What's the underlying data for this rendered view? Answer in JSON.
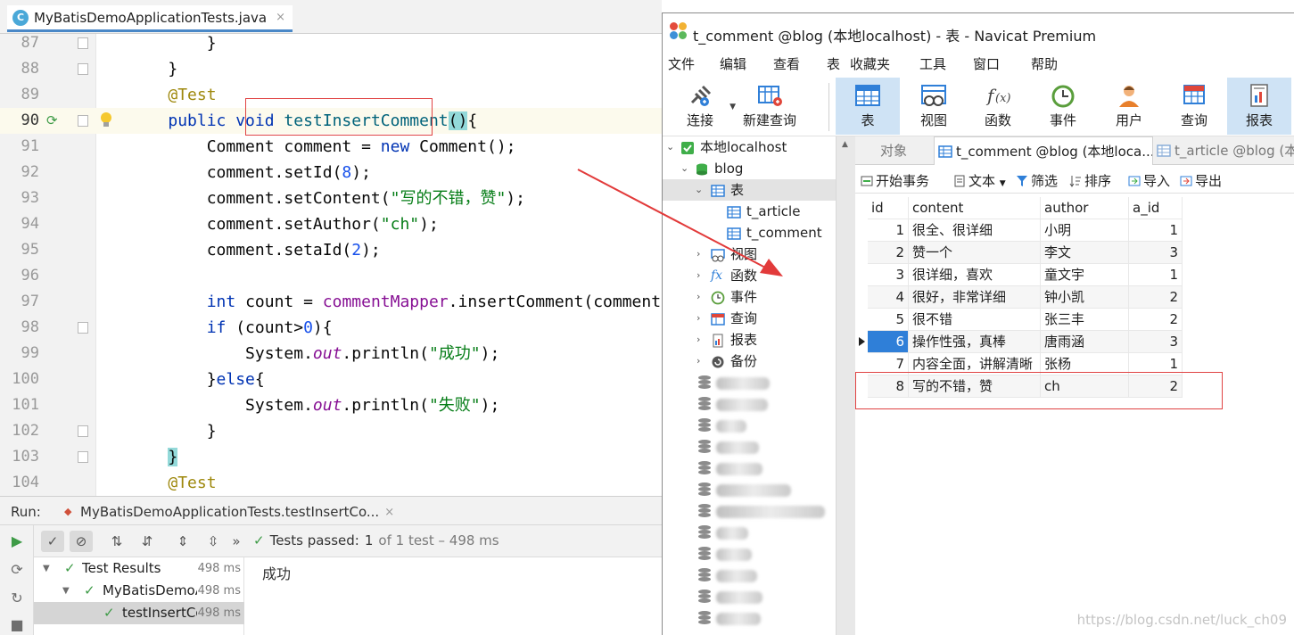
{
  "ide": {
    "tab_label": "MyBatisDemoApplicationTests.java",
    "tab_icon_letter": "C",
    "tab_close": "×",
    "lines": [
      {
        "n": "87",
        "parts": [
          {
            "t": "        }",
            "c": ""
          }
        ]
      },
      {
        "n": "88",
        "parts": [
          {
            "t": "    }",
            "c": ""
          }
        ]
      },
      {
        "n": "89",
        "parts": [
          {
            "t": "    ",
            "c": ""
          },
          {
            "t": "@Test",
            "c": "ann"
          }
        ]
      },
      {
        "n": "90",
        "parts": [
          {
            "t": "    ",
            "c": ""
          },
          {
            "t": "public void ",
            "c": "kw"
          },
          {
            "t": "testInsertComment",
            "c": "mth"
          },
          {
            "t": "()",
            "c": "brace-hl"
          },
          {
            "t": "{",
            "c": ""
          }
        ]
      },
      {
        "n": "91",
        "parts": [
          {
            "t": "        Comment comment = ",
            "c": ""
          },
          {
            "t": "new ",
            "c": "kw"
          },
          {
            "t": "Comment();",
            "c": ""
          }
        ]
      },
      {
        "n": "92",
        "parts": [
          {
            "t": "        comment.setId(",
            "c": ""
          },
          {
            "t": "8",
            "c": "num"
          },
          {
            "t": ");",
            "c": ""
          }
        ]
      },
      {
        "n": "93",
        "parts": [
          {
            "t": "        comment.setContent(",
            "c": ""
          },
          {
            "t": "\"写的不错，赞\"",
            "c": "str"
          },
          {
            "t": ");",
            "c": ""
          }
        ]
      },
      {
        "n": "94",
        "parts": [
          {
            "t": "        comment.setAuthor(",
            "c": ""
          },
          {
            "t": "\"ch\"",
            "c": "str"
          },
          {
            "t": ");",
            "c": ""
          }
        ]
      },
      {
        "n": "95",
        "parts": [
          {
            "t": "        comment.setaId(",
            "c": ""
          },
          {
            "t": "2",
            "c": "num"
          },
          {
            "t": ");",
            "c": ""
          }
        ]
      },
      {
        "n": "96",
        "parts": []
      },
      {
        "n": "97",
        "parts": [
          {
            "t": "        ",
            "c": ""
          },
          {
            "t": "int ",
            "c": "kw"
          },
          {
            "t": "count = ",
            "c": ""
          },
          {
            "t": "commentMapper",
            "c": "fld"
          },
          {
            "t": ".insertComment(comment);",
            "c": ""
          }
        ]
      },
      {
        "n": "98",
        "parts": [
          {
            "t": "        ",
            "c": ""
          },
          {
            "t": "if ",
            "c": "kw"
          },
          {
            "t": "(count>",
            "c": ""
          },
          {
            "t": "0",
            "c": "num"
          },
          {
            "t": "){",
            "c": ""
          }
        ]
      },
      {
        "n": "99",
        "parts": [
          {
            "t": "            System.",
            "c": ""
          },
          {
            "t": "out",
            "c": "stat"
          },
          {
            "t": ".println(",
            "c": ""
          },
          {
            "t": "\"成功\"",
            "c": "str"
          },
          {
            "t": ");",
            "c": ""
          }
        ]
      },
      {
        "n": "100",
        "parts": [
          {
            "t": "        }",
            "c": ""
          },
          {
            "t": "else",
            "c": "kw"
          },
          {
            "t": "{",
            "c": ""
          }
        ]
      },
      {
        "n": "101",
        "parts": [
          {
            "t": "            System.",
            "c": ""
          },
          {
            "t": "out",
            "c": "stat"
          },
          {
            "t": ".println(",
            "c": ""
          },
          {
            "t": "\"失败\"",
            "c": "str"
          },
          {
            "t": ");",
            "c": ""
          }
        ]
      },
      {
        "n": "102",
        "parts": [
          {
            "t": "        }",
            "c": ""
          }
        ]
      },
      {
        "n": "103",
        "parts": [
          {
            "t": "    ",
            "c": ""
          },
          {
            "t": "}",
            "c": "brace-hl"
          }
        ]
      },
      {
        "n": "104",
        "parts": [
          {
            "t": "    ",
            "c": ""
          },
          {
            "t": "@Test",
            "c": "ann"
          }
        ]
      }
    ]
  },
  "run": {
    "label": "Run:",
    "config_name": "MyBatisDemoApplicationTests.testInsertCo...",
    "config_close": "×",
    "more": "»",
    "status_passed": "Tests passed:",
    "status_count": "1",
    "status_rest": "of 1 test – 498 ms",
    "tree": [
      {
        "label": "Test Results",
        "time": "498 ms"
      },
      {
        "label": "MyBatisDemoA",
        "time": "498 ms"
      },
      {
        "label": "testInsertCo",
        "time": "498 ms"
      }
    ],
    "console_output": "成功"
  },
  "navicat": {
    "title": "t_comment @blog (本地localhost) - 表 - Navicat Premium",
    "menu": [
      "文件",
      "编辑",
      "查看",
      "表",
      "收藏夹",
      "工具",
      "窗口",
      "帮助"
    ],
    "toolbar": [
      {
        "label": "连接",
        "icon": "plug-icon"
      },
      {
        "label": "新建查询",
        "icon": "new-query-icon"
      },
      {
        "label": "表",
        "icon": "table-icon"
      },
      {
        "label": "视图",
        "icon": "view-icon"
      },
      {
        "label": "函数",
        "icon": "function-icon"
      },
      {
        "label": "事件",
        "icon": "clock-icon"
      },
      {
        "label": "用户",
        "icon": "user-icon"
      },
      {
        "label": "查询",
        "icon": "query-icon"
      },
      {
        "label": "报表",
        "icon": "report-icon"
      }
    ],
    "tree": {
      "connection": "本地localhost",
      "database": "blog",
      "tables_node": "表",
      "tables": [
        "t_article",
        "t_comment"
      ],
      "other_nodes": [
        "视图",
        "函数",
        "事件",
        "查询",
        "报表",
        "备份"
      ],
      "blurred_db_count": 12
    },
    "tabs": [
      "对象",
      "t_comment @blog (本地loca...",
      "t_article @blog (本"
    ],
    "subtoolbar": [
      "开始事务",
      "文本",
      "筛选",
      "排序",
      "导入",
      "导出"
    ],
    "columns": [
      "id",
      "content",
      "author",
      "a_id"
    ],
    "rows": [
      [
        "1",
        "很全、很详细",
        "小明",
        "1"
      ],
      [
        "2",
        "赞一个",
        "李文",
        "3"
      ],
      [
        "3",
        "很详细，喜欢",
        "童文宇",
        "1"
      ],
      [
        "4",
        "很好，非常详细",
        "钟小凯",
        "2"
      ],
      [
        "5",
        "很不错",
        "张三丰",
        "2"
      ],
      [
        "6",
        "操作性强，真棒",
        "唐雨涵",
        "3"
      ],
      [
        "7",
        "内容全面，讲解清晰",
        "张杨",
        "1"
      ],
      [
        "8",
        "写的不错，赞",
        "ch",
        "2"
      ]
    ],
    "selected_row_id": "6"
  },
  "watermark": "https://blog.csdn.net/luck_ch09",
  "colors": {
    "highlight_box": "#e04343",
    "arrow": "#e23a3a",
    "selection": "#2f7fd8",
    "pass_green": "#3e9b47"
  }
}
